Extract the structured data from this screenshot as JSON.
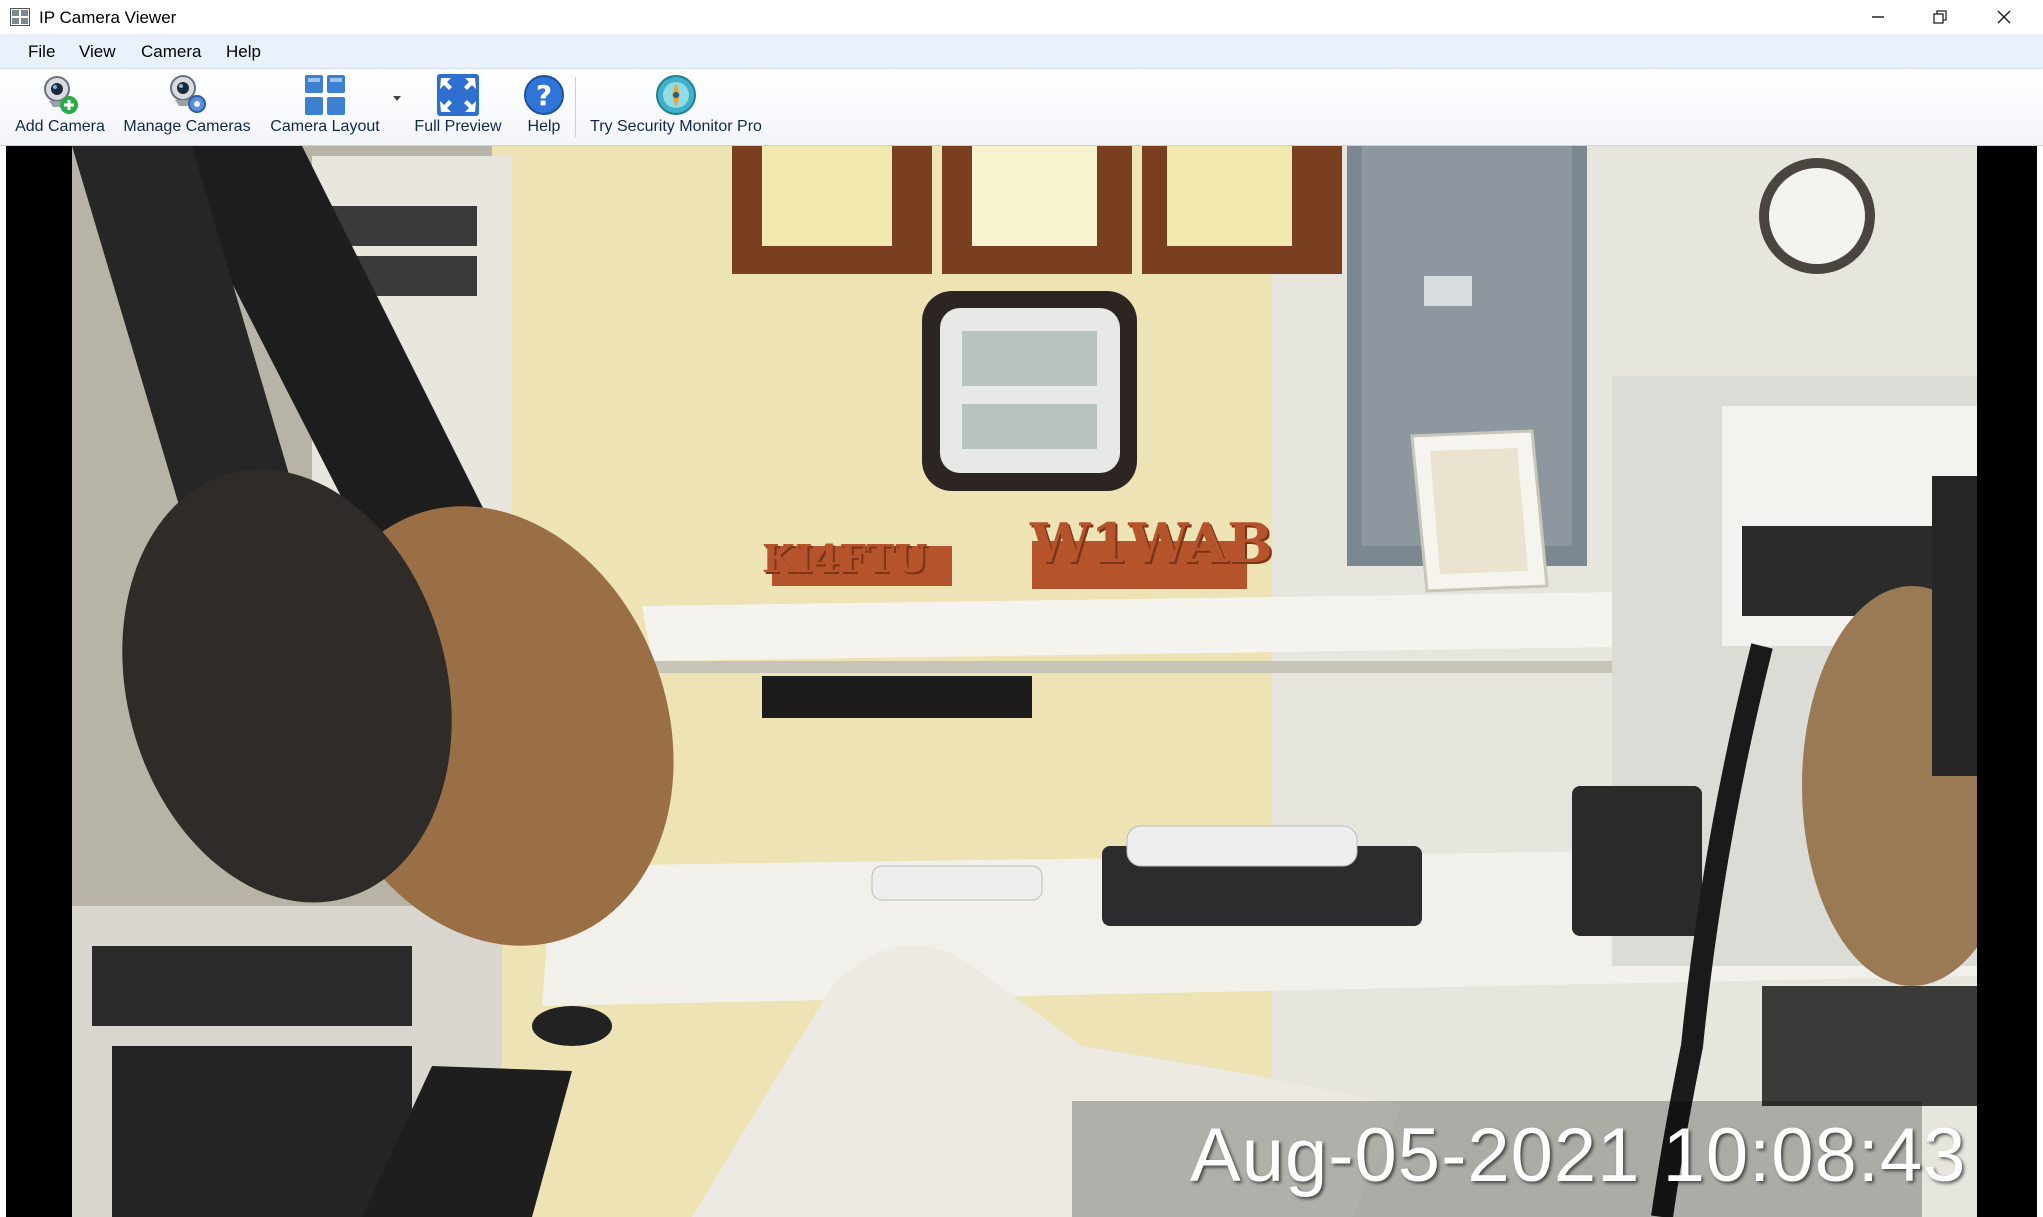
{
  "window": {
    "title": "IP Camera Viewer"
  },
  "menu": {
    "items": [
      "File",
      "View",
      "Camera",
      "Help"
    ]
  },
  "toolbar": {
    "add_camera": "Add Camera",
    "manage_cameras": "Manage Cameras",
    "camera_layout": "Camera Layout",
    "full_preview": "Full Preview",
    "help": "Help",
    "try_pro": "Try Security Monitor Pro"
  },
  "feed": {
    "timestamp": "Aug-05-2021 10:08:43",
    "sign_left": "KI4FTU",
    "sign_right": "W1WAB"
  },
  "colors": {
    "menu_bg": "#eaf1fb",
    "viewer_bg": "#000000",
    "toolbar_text": "#14284b"
  }
}
